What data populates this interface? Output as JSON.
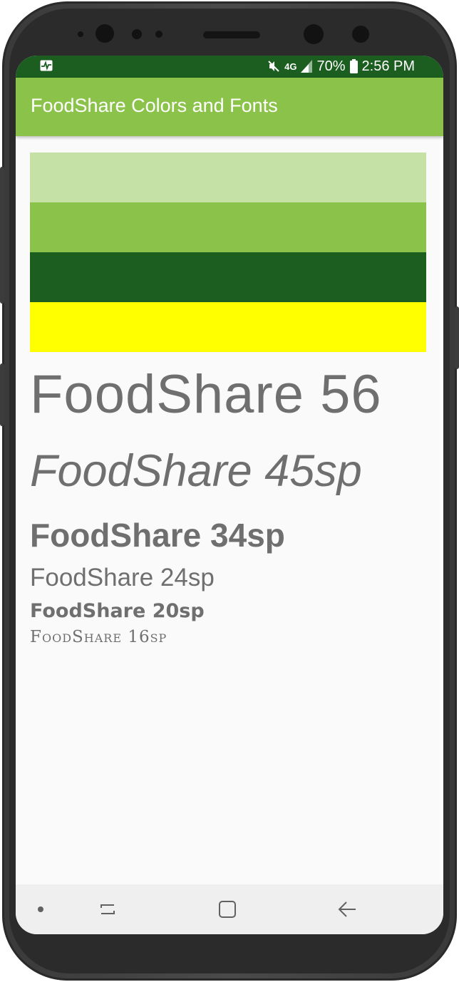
{
  "status_bar": {
    "battery": "70%",
    "time": "2:56 PM",
    "network": "4G"
  },
  "app_bar": {
    "title": "FoodShare Colors and Fonts"
  },
  "swatches": [
    {
      "name": "light-green",
      "color": "#c5e1a5"
    },
    {
      "name": "green",
      "color": "#8bc34a"
    },
    {
      "name": "dark-green",
      "color": "#1b5e20"
    },
    {
      "name": "yellow",
      "color": "#ffff00"
    }
  ],
  "font_samples": {
    "s56": "FoodShare 56",
    "s45": "FoodShare 45sp",
    "s34": "FoodShare 34sp",
    "s24": "FoodShare 24sp",
    "s20": "FoodShare 20sp",
    "s16": "FoodShare 16sp"
  },
  "nav_bar": {
    "icons": [
      "dot-indicator",
      "recents-icon",
      "home-icon",
      "back-icon"
    ]
  }
}
